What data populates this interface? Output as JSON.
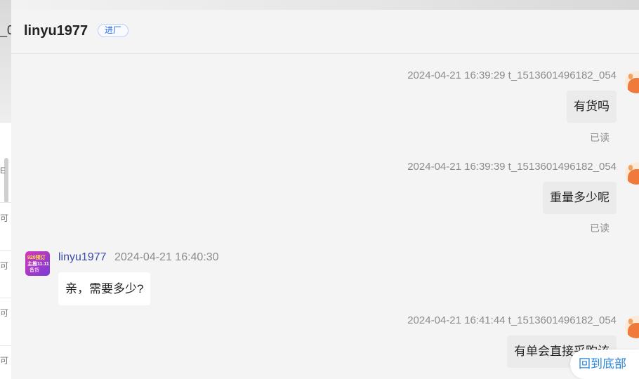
{
  "left_panel": {
    "fragments": [
      "_0",
      "E",
      "可",
      "可",
      "可",
      "可"
    ]
  },
  "header": {
    "title": "linyu1977",
    "tag": "进厂"
  },
  "messages": [
    {
      "side": "right",
      "meta": "2024-04-21 16:39:29  t_1513601496182_054",
      "text": "有货吗",
      "status": "已读"
    },
    {
      "side": "right",
      "meta": "2024-04-21 16:39:39  t_1513601496182_054",
      "text": "重量多少呢",
      "status": "已读"
    },
    {
      "side": "left",
      "name": "linyu1977",
      "time": "2024-04-21 16:40:30",
      "text": "亲，需要多少?",
      "avatar_text": [
        "920预订",
        "主推11.11",
        "备货"
      ]
    },
    {
      "side": "right",
      "meta": "2024-04-21 16:41:44  t_1513601496182_054",
      "text": "有单会直接采购该"
    }
  ],
  "back_to_bottom": "回到底部",
  "colors": {
    "accent_blue": "#2a86d8",
    "name_blue": "#3a4aa8",
    "avatar_orange": "#f07a3c"
  }
}
